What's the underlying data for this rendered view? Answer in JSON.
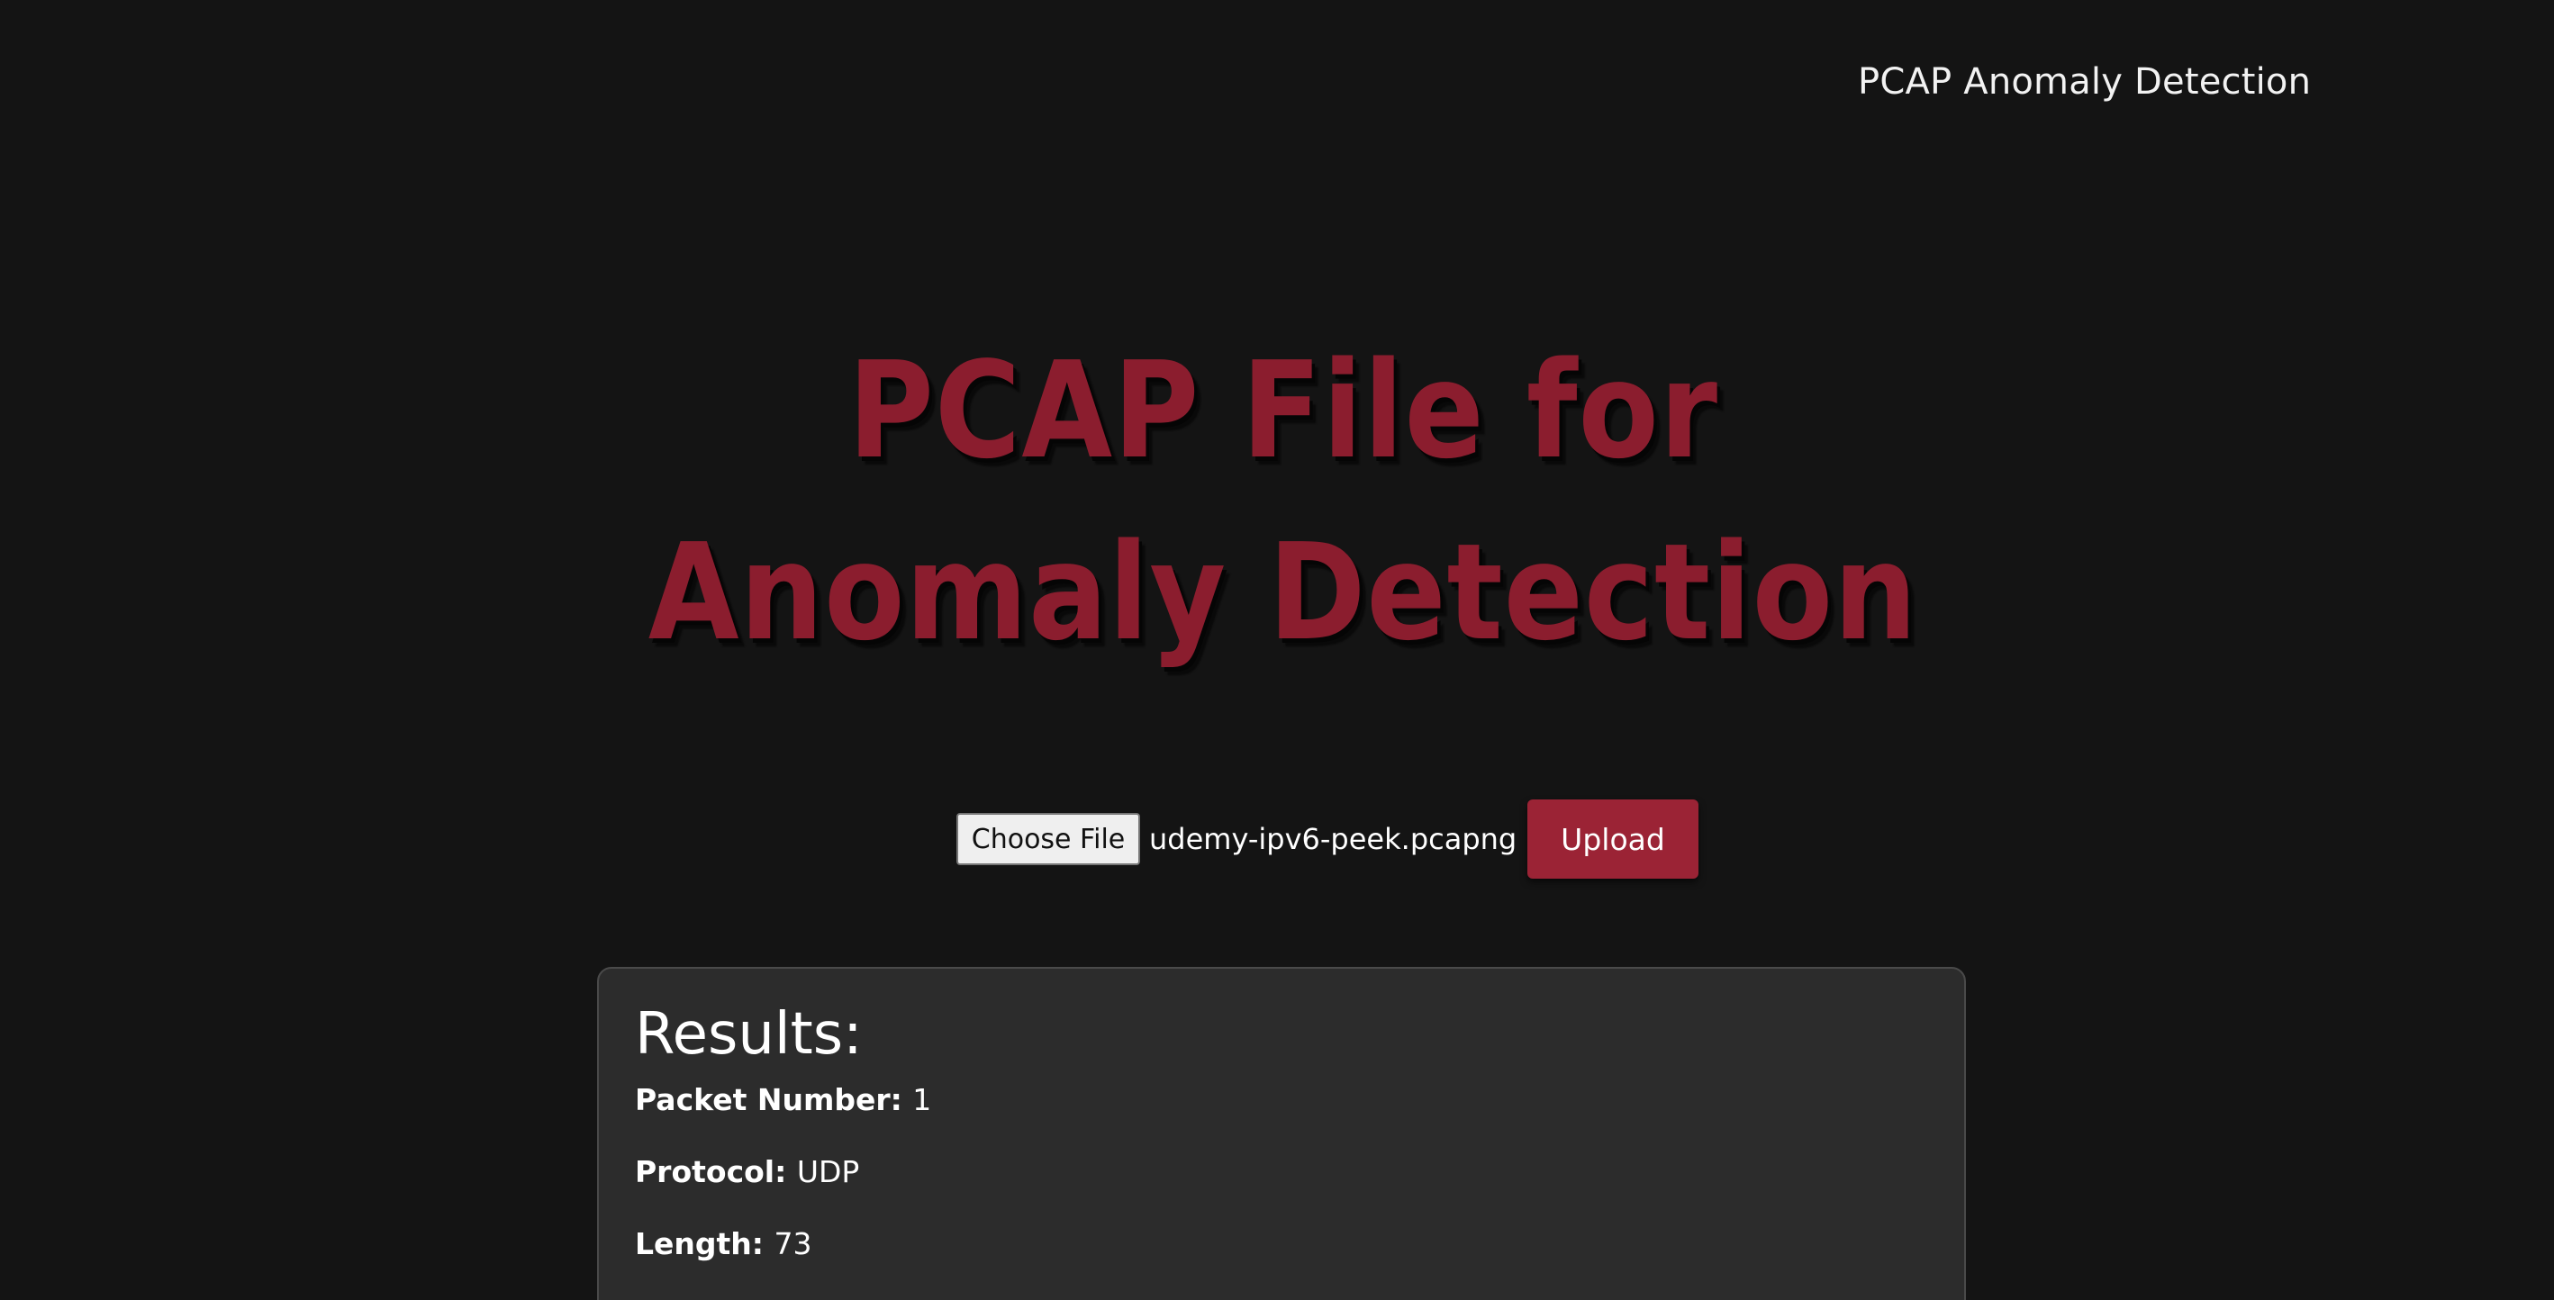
{
  "header": {
    "app_title": "PCAP Anomaly Detection"
  },
  "hero": {
    "line1": "PCAP File for",
    "line2": "Anomaly Detection",
    "color": "#8b1d2e"
  },
  "upload": {
    "choose_label": "Choose File",
    "file_name": "udemy-ipv6-peek.pcapng",
    "upload_label": "Upload",
    "button_color": "#9b2335"
  },
  "results": {
    "title": "Results:",
    "fields": [
      {
        "label": "Packet Number:",
        "value": "1"
      },
      {
        "label": "Protocol:",
        "value": "UDP"
      },
      {
        "label": "Length:",
        "value": "73"
      }
    ]
  }
}
